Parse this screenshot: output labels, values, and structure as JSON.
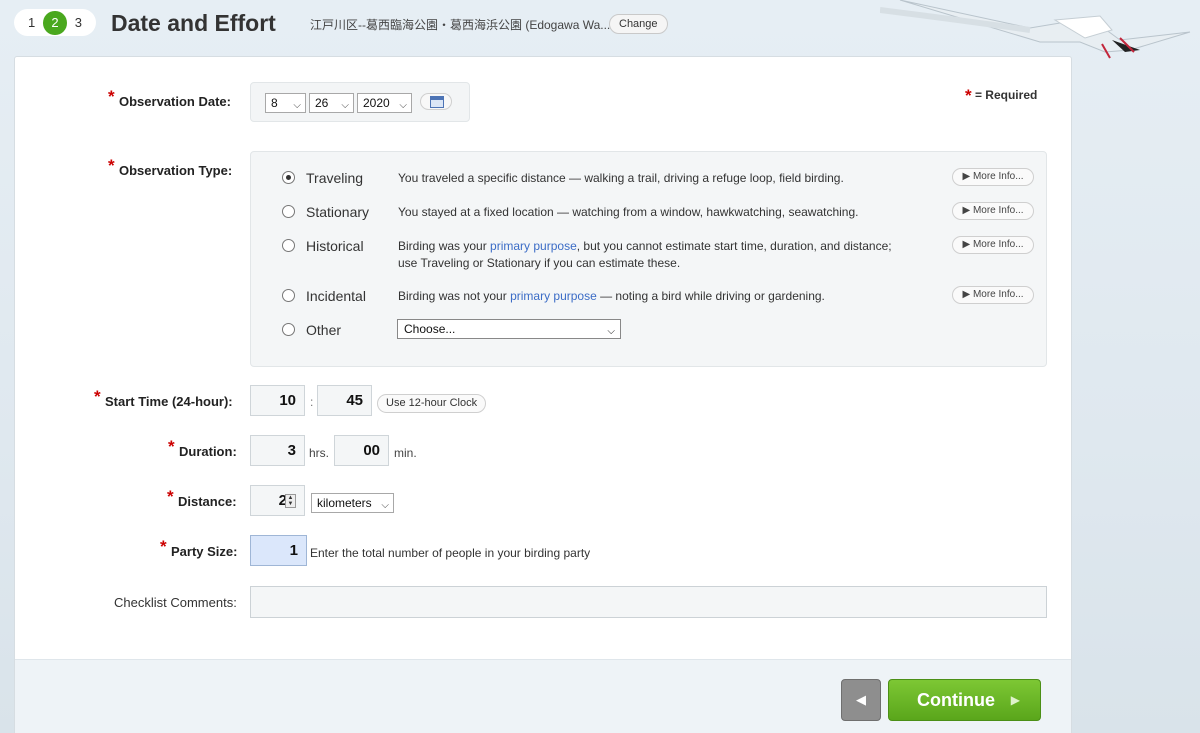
{
  "header": {
    "steps": [
      "1",
      "2",
      "3"
    ],
    "active_step": "2",
    "title": "Date and Effort",
    "location": "江戸川区--葛西臨海公園・葛西海浜公園 (Edogawa Wa...",
    "change_label": "Change"
  },
  "required_note": "= Required",
  "date": {
    "label": "Observation Date:",
    "month": "8",
    "day": "26",
    "year": "2020"
  },
  "observation_type": {
    "label": "Observation Type:",
    "more_info": "More Info...",
    "options": [
      {
        "name": "Traveling",
        "checked": true,
        "desc": "You traveled a specific distance — walking a trail, driving a refuge loop, field birding."
      },
      {
        "name": "Stationary",
        "checked": false,
        "desc": "You stayed at a fixed location — watching from a window, hawkwatching, seawatching."
      },
      {
        "name": "Historical",
        "checked": false,
        "desc_pre": "Birding was your ",
        "desc_link": "primary purpose",
        "desc_post": ", but you cannot estimate start time, duration, and distance;",
        "desc_line2": "use Traveling or Stationary if you can estimate these."
      },
      {
        "name": "Incidental",
        "checked": false,
        "desc_pre": "Birding was not your ",
        "desc_link": "primary purpose",
        "desc_post": " — noting a bird while driving or gardening."
      },
      {
        "name": "Other",
        "checked": false,
        "select": "Choose..."
      }
    ]
  },
  "start_time": {
    "label": "Start Time (24-hour):",
    "hour": "10",
    "minute": "45",
    "separator": ":",
    "clock_btn": "Use 12-hour Clock"
  },
  "duration": {
    "label": "Duration:",
    "hours": "3",
    "hours_unit": "hrs.",
    "minutes": "00",
    "minutes_unit": "min."
  },
  "distance": {
    "label": "Distance:",
    "value": "2",
    "unit": "kilometers"
  },
  "party_size": {
    "label": "Party Size:",
    "value": "1",
    "hint": "Enter the total number of people in your birding party"
  },
  "comments": {
    "label": "Checklist Comments:",
    "value": ""
  },
  "footer": {
    "back_icon": "◀",
    "continue_label": "Continue"
  },
  "colors": {
    "accent_green": "#5aa61b",
    "required_red": "#cc0000",
    "link_blue": "#3b6cc6"
  }
}
